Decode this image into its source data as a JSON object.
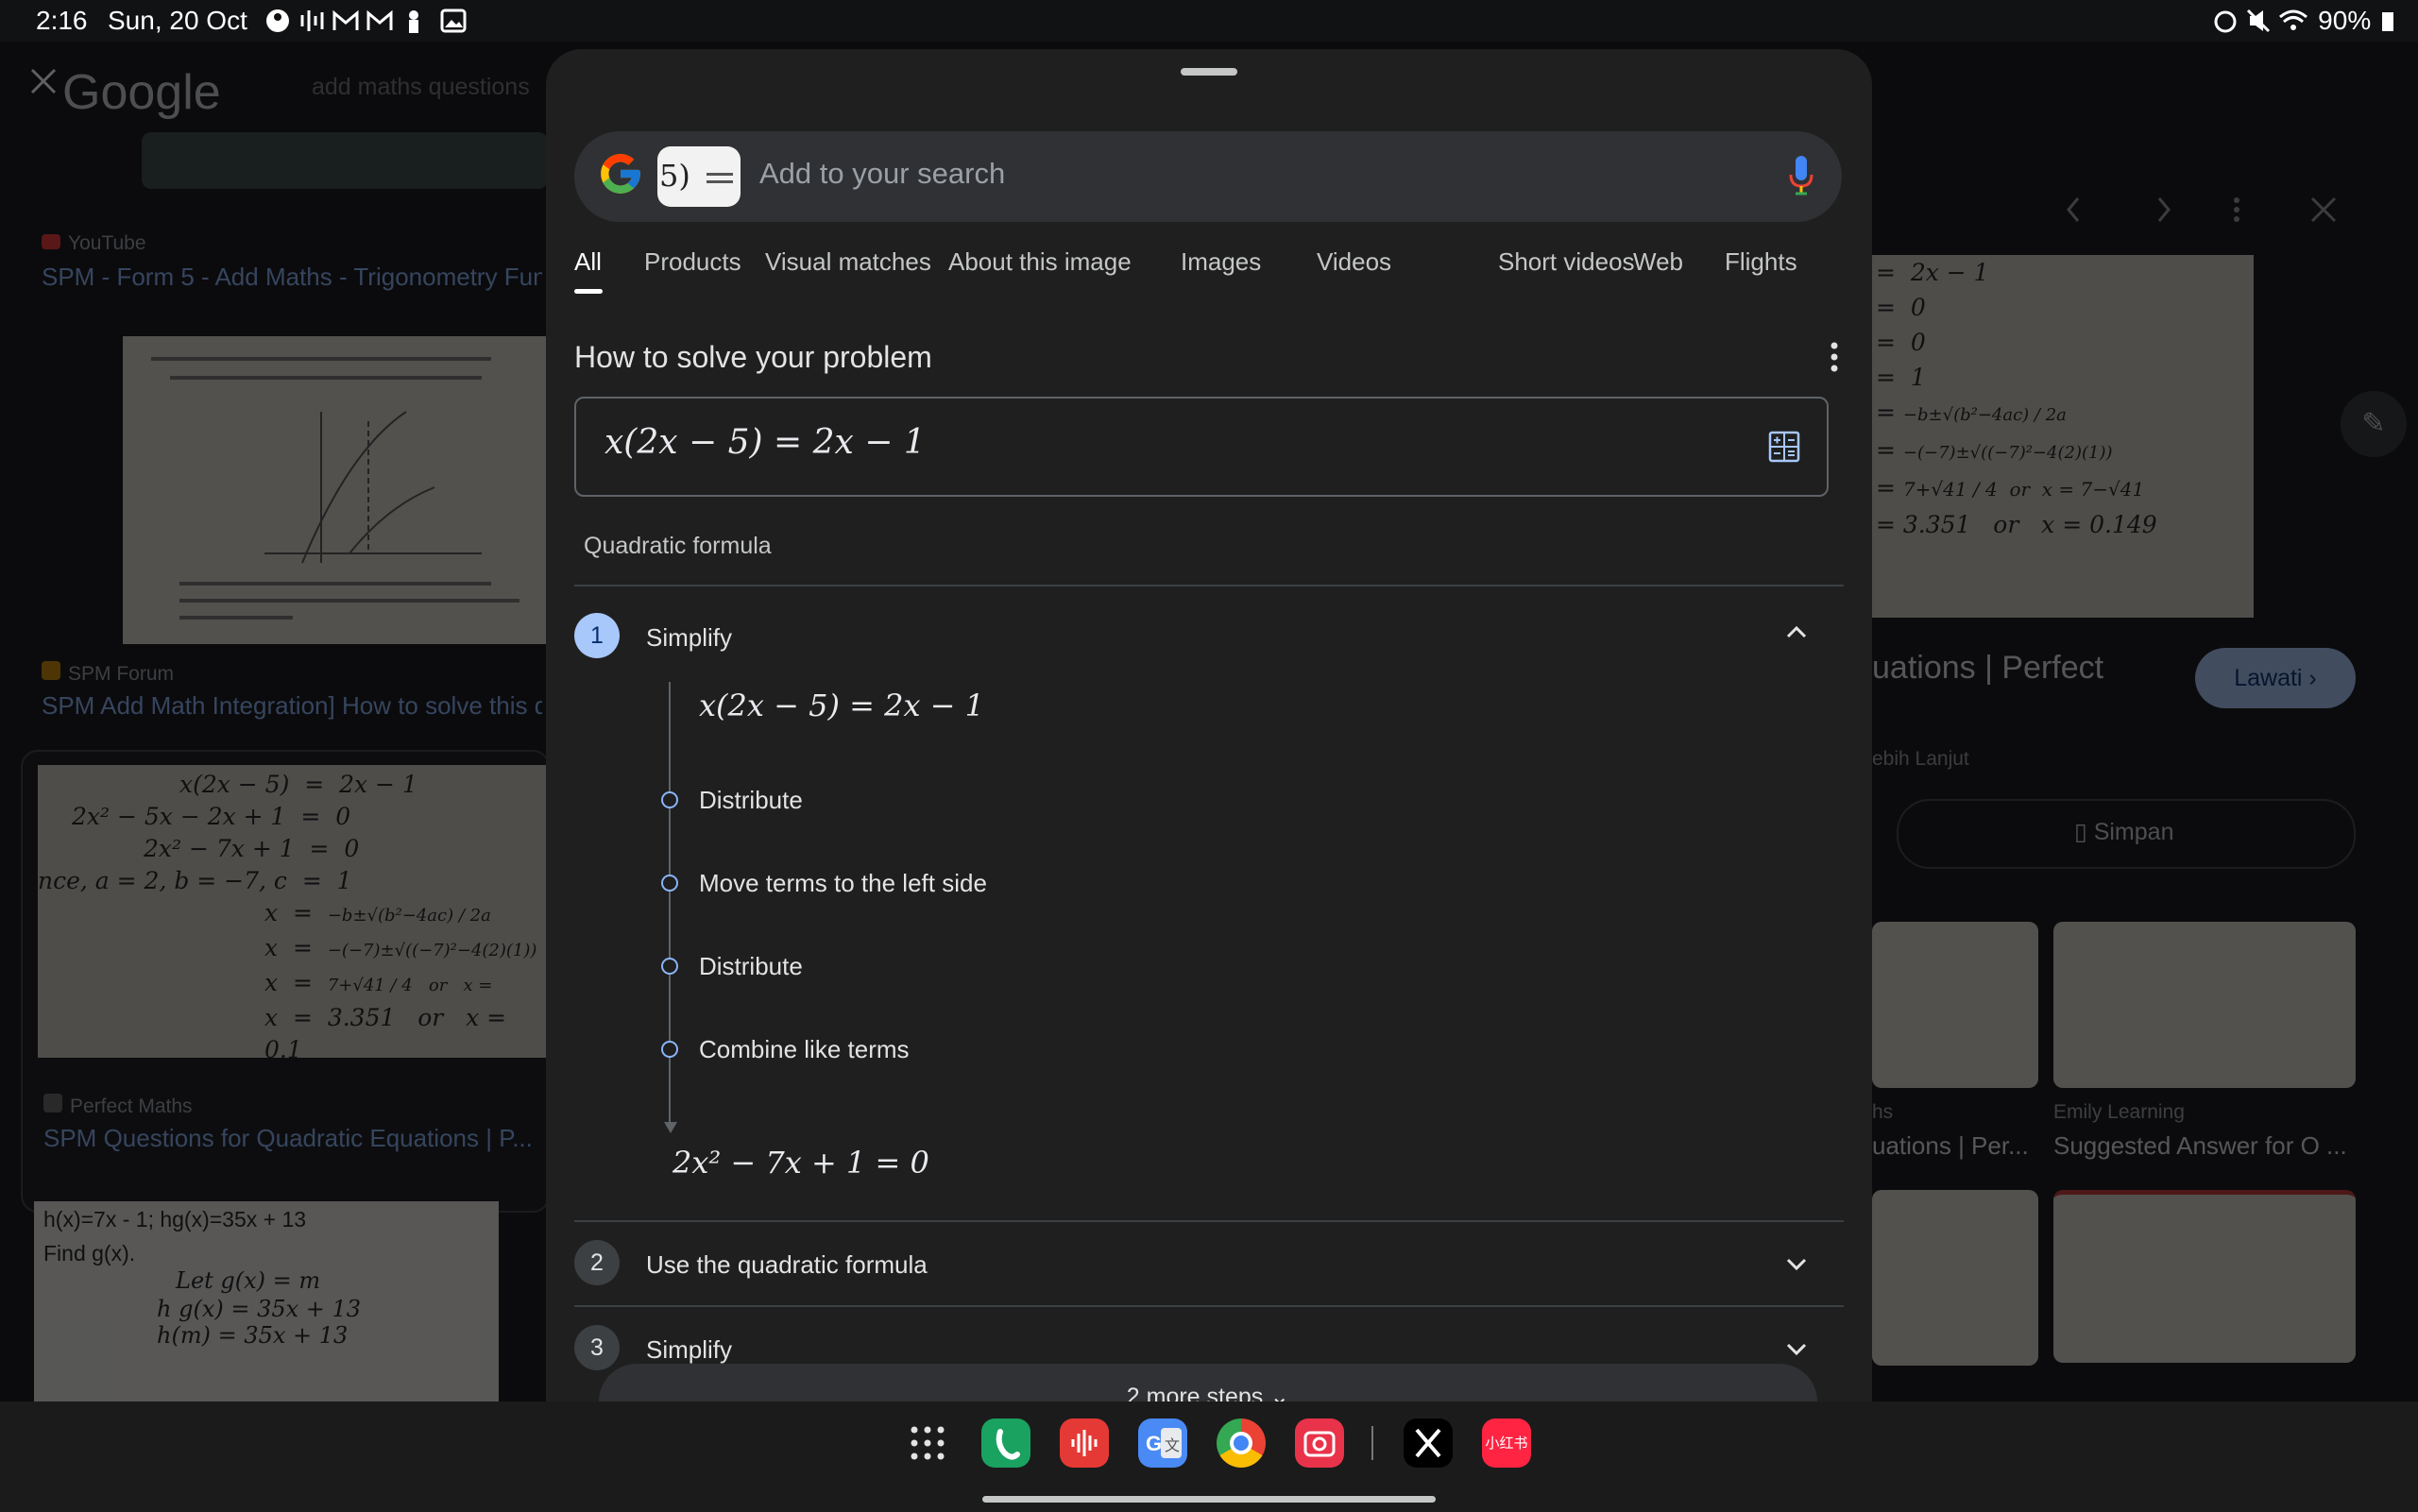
{
  "status_bar": {
    "time": "2:16",
    "date": "Sun, 20 Oct",
    "battery": "90%"
  },
  "background": {
    "close_icon": "close-icon",
    "logo": "Google",
    "query": "add maths questions",
    "results_left": [
      {
        "source": "YouTube",
        "title": "SPM - Form 5 - Add Maths - Trigonometry Fun"
      },
      {
        "source": "SPM Forum",
        "title": "SPM Add Math Integration] How to solve this q"
      },
      {
        "source": "Perfect Maths",
        "title": "SPM Questions for Quadratic Equations | P..."
      }
    ],
    "right_panel": {
      "title_fragment": "uations | Perfect",
      "visit_button": "Lawati",
      "more_fragment": "ebih Lanjut",
      "save_button": "Simpan",
      "cards": [
        {
          "source": "hs",
          "title": "uations | Per..."
        },
        {
          "source": "Emily Learning",
          "title": "Suggested Answer for O ..."
        }
      ]
    },
    "handwritten_lines": [
      "h(x)=7x - 1;  hg(x)=35x + 13",
      "Find g(x).",
      "Let g(x) = m",
      "h g(x) = 35x + 13",
      "h(m) = 35x + 13"
    ]
  },
  "sheet": {
    "search_placeholder": "Add to your search",
    "thumb_chip_text": "5)",
    "tabs": [
      "All",
      "Products",
      "Visual matches",
      "About this image",
      "Images",
      "Videos",
      "Short videos",
      "Web",
      "Flights"
    ],
    "active_tab": "All",
    "section_title": "How to solve your problem",
    "equation": "x(2x − 5) = 2x − 1",
    "method": "Quadratic formula",
    "steps": [
      {
        "number": "1",
        "label": "Simplify",
        "expanded": true,
        "start_expr": "x(2x − 5) = 2x − 1",
        "substeps": [
          "Distribute",
          "Move terms to the left side",
          "Distribute",
          "Combine like terms"
        ],
        "result_expr": "2x² − 7x + 1 = 0"
      },
      {
        "number": "2",
        "label": "Use the quadratic formula",
        "expanded": false
      },
      {
        "number": "3",
        "label": "Simplify",
        "expanded": false
      }
    ],
    "more_steps_label": "2 more steps"
  },
  "taskbar": {
    "apps": [
      "app-drawer-icon",
      "phone-icon",
      "recorder-icon",
      "translate-icon",
      "chrome-icon",
      "camera-icon",
      "x-icon",
      "xiaohongshu-icon"
    ],
    "xiaohongshu_label": "小红书"
  },
  "colors": {
    "sheet_bg": "#1f1f1f",
    "accent_blue": "#8ab4f8",
    "step_active": "#a8c7fa"
  }
}
